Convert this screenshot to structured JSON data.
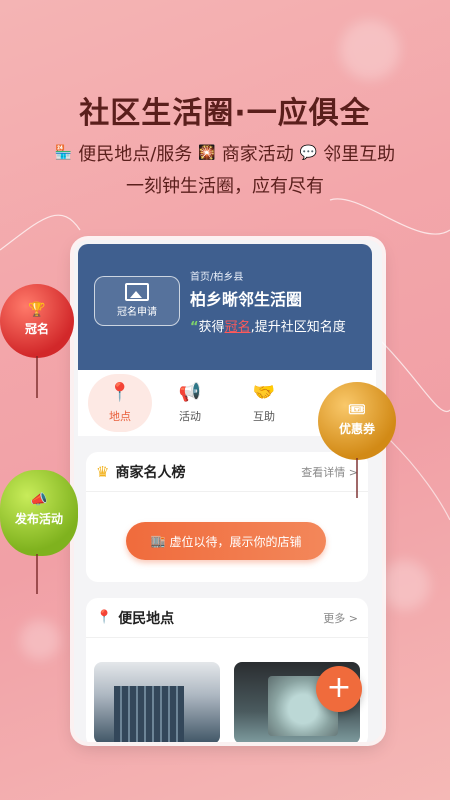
{
  "promo": {
    "headline": "社区生活圈·一应俱全",
    "features": [
      "便民地点/服务",
      "商家活动",
      "邻里互助"
    ],
    "tagline": "一刻钟生活圈，应有尽有"
  },
  "banner": {
    "apply_label": "冠名申请",
    "breadcrumb": "首页/柏乡县",
    "title": "柏乡晰邻生活圈",
    "slogan_quote": "“",
    "slogan_prefix": "获得",
    "slogan_highlight": "冠名",
    "slogan_suffix": ",提升社区知名度"
  },
  "nav": {
    "items": [
      {
        "label": "地点",
        "icon": "location-pin-icon"
      },
      {
        "label": "活动",
        "icon": "megaphone-icon"
      },
      {
        "label": "互助",
        "icon": "handshake-icon"
      }
    ],
    "active_index": 0
  },
  "merchant_card": {
    "title": "商家名人榜",
    "more": "查看详情 >",
    "cta": "虚位以待，展示你的店铺"
  },
  "places_card": {
    "title": "便民地点",
    "more": "更多 >"
  },
  "balloons": {
    "red": "冠名",
    "green": "发布活动",
    "gold": "优惠券"
  },
  "colors": {
    "accent": "#f06b3c",
    "banner_bg": "#3f5f8f",
    "background": "#f3a6aa"
  }
}
